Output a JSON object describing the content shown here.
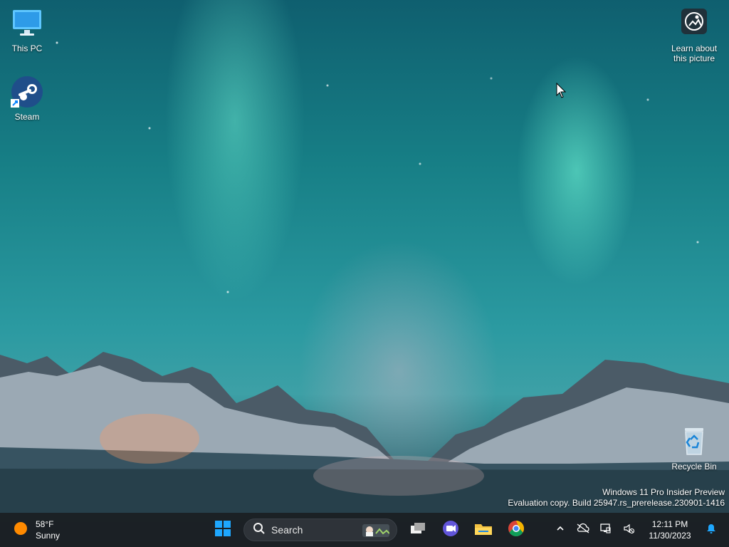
{
  "desktop": {
    "icons": [
      {
        "label": "This PC",
        "icon": "monitor-icon"
      },
      {
        "label": "Steam",
        "icon": "steam-icon"
      },
      {
        "label": "Learn about\nthis picture",
        "icon": "learn-about-picture-icon"
      },
      {
        "label": "Recycle Bin",
        "icon": "recycle-bin-icon"
      }
    ],
    "watermark": {
      "line1": "Windows 11 Pro Insider Preview",
      "line2": "Evaluation copy. Build 25947.rs_prerelease.230901-1416"
    }
  },
  "taskbar": {
    "weather": {
      "temperature": "58°F",
      "condition": "Sunny",
      "icon": "sun-icon"
    },
    "search": {
      "placeholder": "Search",
      "icon": "search-icon"
    },
    "apps": [
      {
        "name": "Start",
        "icon": "windows-start-icon"
      },
      {
        "name": "Task View",
        "icon": "task-view-icon"
      },
      {
        "name": "Meet",
        "icon": "video-meeting-icon"
      },
      {
        "name": "File Explorer",
        "icon": "folder-icon"
      },
      {
        "name": "Chrome",
        "icon": "chrome-icon"
      }
    ],
    "tray": {
      "time": "12:11 PM",
      "date": "11/30/2023",
      "icons": [
        "chevron-up-icon",
        "cloud-off-icon",
        "network-icon",
        "volume-muted-icon",
        "notification-bell-icon"
      ]
    }
  },
  "colors": {
    "taskbar_bg": "#1b1f23",
    "accent_blue": "#0a84ff",
    "steam_blue": "#1f4e8a",
    "weather_orange": "#ff8a00"
  }
}
